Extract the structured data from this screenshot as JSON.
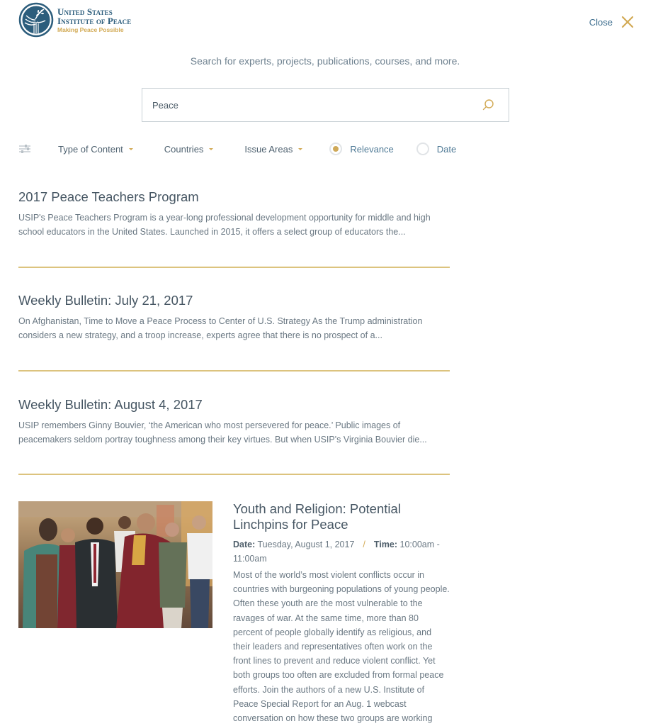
{
  "header": {
    "logo": {
      "line1": "United States",
      "line2": "Institute of Peace",
      "tagline": "Making Peace Possible"
    },
    "close_label": "Close",
    "close_icon": "close-x-icon"
  },
  "search": {
    "hint": "Search for experts, projects, publications, courses, and more.",
    "value": "Peace",
    "icon": "search-icon"
  },
  "filters": {
    "icon": "sliders-icon",
    "dropdowns": [
      {
        "label": "Type of Content"
      },
      {
        "label": "Countries"
      },
      {
        "label": "Issue Areas"
      }
    ],
    "sort": {
      "options": [
        {
          "label": "Relevance",
          "selected": true
        },
        {
          "label": "Date",
          "selected": false
        }
      ]
    }
  },
  "colors": {
    "accent_gold": "#d2aa55",
    "brand_blue": "#2c5d7c",
    "divider": "#dcc37e"
  },
  "results": [
    {
      "title": "2017 Peace Teachers Program",
      "snippet": "USIP's Peace Teachers Program is a year-long professional development opportunity for middle and high school educators in the United States. Launched in 2015, it offers a select group of educators the..."
    },
    {
      "title": "Weekly Bulletin: July 21, 2017",
      "snippet": "On Afghanistan, Time to Move a Peace Process to Center of U.S. Strategy As the Trump administration considers a new strategy, and a troop increase, experts agree that there is no prospect of a..."
    },
    {
      "title": "Weekly Bulletin: August 4, 2017",
      "snippet": "USIP remembers Ginny Bouvier, ‘the American who most persevered for peace.’ Public images of peacemakers seldom portray toughness among their key virtues. But when USIP's Virginia Bouvier die..."
    }
  ],
  "event": {
    "title": "Youth and Religion: Potential Linchpins for Peace",
    "date_label": "Date:",
    "date_value": "Tuesday, August 1, 2017",
    "separator": "/",
    "time_label": "Time:",
    "time_value": "10:00am - 11:00am",
    "description": "Most of the world’s most violent conflicts occur in countries with burgeoning populations of young people. Often these youth are the most vulnerable to the ravages of war. At the same time, more than 80 percent of people globally identify as religious, and their leaders and representatives often work on the front lines to prevent and reduce violent conflict. Yet both groups too often are excluded from formal peace efforts. Join the authors of a new U.S. Institute of Peace Special Report for an Aug. 1 webcast conversation on how these two groups are working",
    "image_alt": "Group photo with a monk in maroon robes holding hands with participants"
  }
}
